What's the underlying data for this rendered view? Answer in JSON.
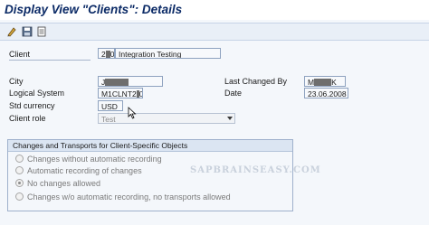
{
  "window": {
    "title": "Display View \"Clients\": Details"
  },
  "toolbar": {
    "buttons": [
      {
        "icon": "change-display-icon"
      },
      {
        "icon": "save-icon"
      },
      {
        "icon": "print-icon"
      }
    ]
  },
  "form": {
    "client_label": "Client",
    "client_value": "2",
    "client_value_suffix": "0",
    "client_desc": "Integration Testing",
    "city_label": "City",
    "city_value": "J",
    "last_changed_label": "Last Changed By",
    "last_changed_value": "M",
    "last_changed_suffix": "K",
    "logical_label": "Logical System",
    "logical_value": "M",
    "logical_mid": "1CLNT2",
    "logical_suffix": "0",
    "date_label": "Date",
    "date_value": "23.06.2008",
    "currency_label": "Std currency",
    "currency_value": "USD",
    "role_label": "Client role",
    "role_value": "Test"
  },
  "transports": {
    "header": "Changes and Transports for Client-Specific Objects",
    "options": [
      {
        "label": "Changes without automatic recording",
        "selected": false
      },
      {
        "label": "Automatic recording of changes",
        "selected": false
      },
      {
        "label": "No changes allowed",
        "selected": true
      },
      {
        "label": "Changes w/o automatic recording, no transports allowed",
        "selected": false
      }
    ]
  },
  "watermark": "SAPBRAINSEASY.COM"
}
